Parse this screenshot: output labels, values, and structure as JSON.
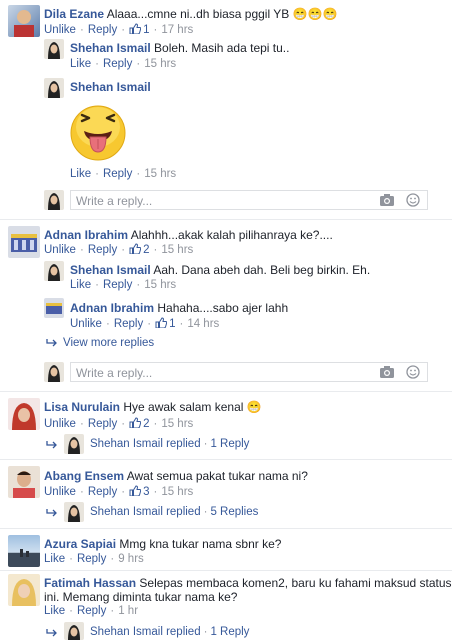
{
  "comments": [
    {
      "name": "Dila Ezane",
      "text": "Alaaa...cmne ni..dh biasa pggil YB 😁😁😁",
      "action": "Unlike",
      "reply": "Reply",
      "likes": "1",
      "time": "17 hrs"
    },
    {
      "name": "Shehan Ismail",
      "text": "Boleh. Masih ada tepi tu..",
      "action": "Like",
      "reply": "Reply",
      "time": "15 hrs"
    },
    {
      "name": "Shehan Ismail",
      "text": "",
      "action": "Like",
      "reply": "Reply",
      "time": "15 hrs"
    },
    {
      "name": "Adnan Ibrahim",
      "text": "Alahhh...akak kalah pilihanraya ke?....",
      "action": "Unlike",
      "reply": "Reply",
      "likes": "2",
      "time": "15 hrs"
    },
    {
      "name": "Shehan Ismail",
      "text": "Aah. Dana abeh dah. Beli beg birkin. Eh.",
      "action": "Like",
      "reply": "Reply",
      "time": "15 hrs"
    },
    {
      "name": "Adnan Ibrahim",
      "text": "Hahaha....sabo ajer lahh",
      "action": "Unlike",
      "reply": "Reply",
      "likes": "1",
      "time": "14 hrs"
    },
    {
      "name": "Lisa Nurulain",
      "text": "Hye awak salam kenal 😁",
      "action": "Unlike",
      "reply": "Reply",
      "likes": "2",
      "time": "15 hrs"
    },
    {
      "name": "Abang Ensem",
      "text": "Awat semua pakat tukar nama ni?",
      "action": "Unlike",
      "reply": "Reply",
      "likes": "3",
      "time": "15 hrs"
    },
    {
      "name": "Azura Sapiai",
      "text": "Mmg kna tukar nama sbnr ke?",
      "action": "Like",
      "reply": "Reply",
      "time": "9 hrs"
    },
    {
      "name": "Fatimah Hassan",
      "text": "Selepas membaca komen2, baru ku fahami maksud status mu",
      "text2": "ini. Memang diminta tukar nama ke?",
      "action": "Like",
      "reply": "Reply",
      "time": "1 hr"
    }
  ],
  "reply_placeholder": "Write a reply...",
  "view_more": "View more replies",
  "replied": [
    {
      "name": "Shehan Ismail replied",
      "count": "1 Reply"
    },
    {
      "name": "Shehan Ismail replied",
      "count": "5 Replies"
    },
    {
      "name": "Shehan Ismail replied",
      "count": "1 Reply"
    }
  ],
  "sep": "·",
  "colors": {
    "link": "#365899",
    "muted": "#90949c",
    "border": "#dddfe2"
  }
}
